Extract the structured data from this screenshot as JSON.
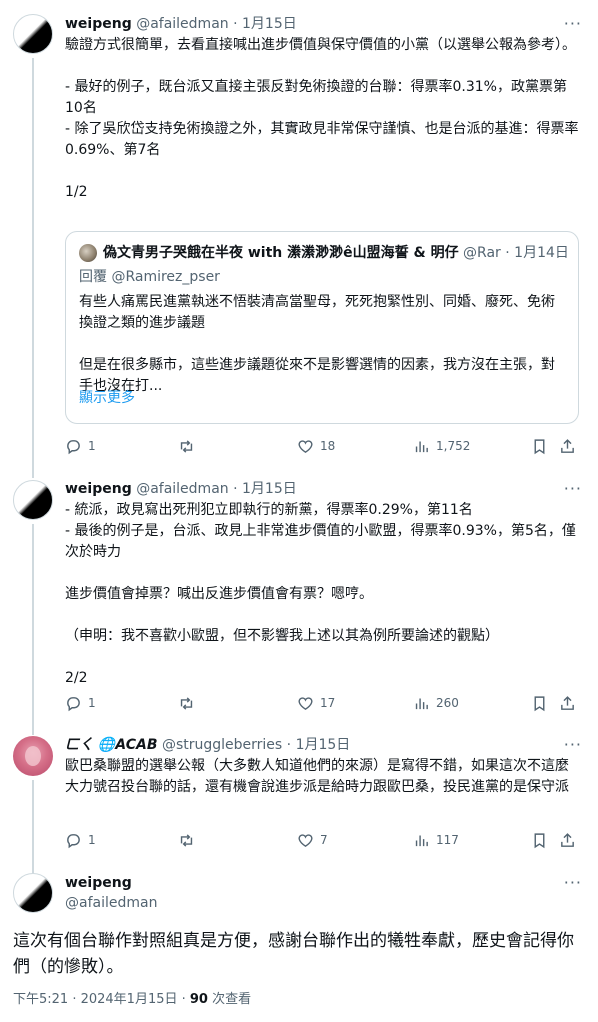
{
  "tweets": [
    {
      "name": "weipeng",
      "handle": "@afailedman",
      "date": "1月15日",
      "text": "驗證方式很簡單，去看直接喊出進步價值與保守價值的小黨（以選舉公報為參考）。\n\n- 最好的例子，既台派又直接主張反對免術換證的台聯：得票率0.31%，政黨票第10名\n- 除了吳欣岱支持免術換證之外，其實政見非常保守謹慎、也是台派的基進：得票率0.69%、第7名\n\n1/2",
      "quote": {
        "name": "偽文青男子哭餓在半夜 with 潫潫渺渺ê山盟海誓 & 明仔",
        "handle": "@Rar",
        "date": "1月14日",
        "reply_prefix": "回覆",
        "reply_to": "@Ramirez_pser",
        "text": "有些人痛罵民進黨執迷不悟裝清高當聖母，死死抱緊性別、同婚、廢死、免術換證之類的進步議題\n\n但是在很多縣市，這些進步議題從來不是影響選情的因素，我方沒在主張，對手也沒在打...",
        "show_more": "顯示更多"
      },
      "stats": {
        "replies": "1",
        "retweets": "",
        "likes": "18",
        "views": "1,752"
      }
    },
    {
      "name": "weipeng",
      "handle": "@afailedman",
      "date": "1月15日",
      "text": "- 統派，政見寫出死刑犯立即執行的新黨，得票率0.29%，第11名\n- 最後的例子是，台派、政見上非常進步價值的小歐盟，得票率0.93%，第5名，僅次於時力\n\n進步價值會掉票？喊出反進步價值會有票？嗯哼。\n\n（申明：我不喜歡小歐盟，但不影響我上述以其為例所要論述的觀點）\n\n2/2",
      "stats": {
        "replies": "1",
        "retweets": "",
        "likes": "17",
        "views": "260"
      }
    },
    {
      "name": "ㄈㄑ 🌐ACAB",
      "handle": "@struggleberries",
      "date": "1月15日",
      "text": "歐巴桑聯盟的選舉公報（大多數人知道他們的來源）是寫得不錯，如果這次不這麼大力號召投台聯的話，還有機會說進步派是給時力跟歐巴桑，投民進黨的是保守派",
      "stats": {
        "replies": "1",
        "retweets": "",
        "likes": "7",
        "views": "117"
      }
    }
  ],
  "main": {
    "name": "weipeng",
    "handle": "@afailedman",
    "text": "這次有個台聯作對照組真是方便，感謝台聯作出的犧牲奉獻，歷史會記得你們（的慘敗）。",
    "time": "下午5:21 · 2024年1月15日 · ",
    "views_count": "90",
    "views_label": " 次查看"
  },
  "ui": {
    "more": "···",
    "dot": " · "
  },
  "colors": {
    "text": "#0f1419",
    "muted": "#536471",
    "link": "#1d9bf0",
    "border": "#cfd9de"
  },
  "icons": [
    "reply-icon",
    "retweet-icon",
    "like-icon",
    "views-icon",
    "bookmark-icon",
    "share-icon",
    "more-icon"
  ]
}
